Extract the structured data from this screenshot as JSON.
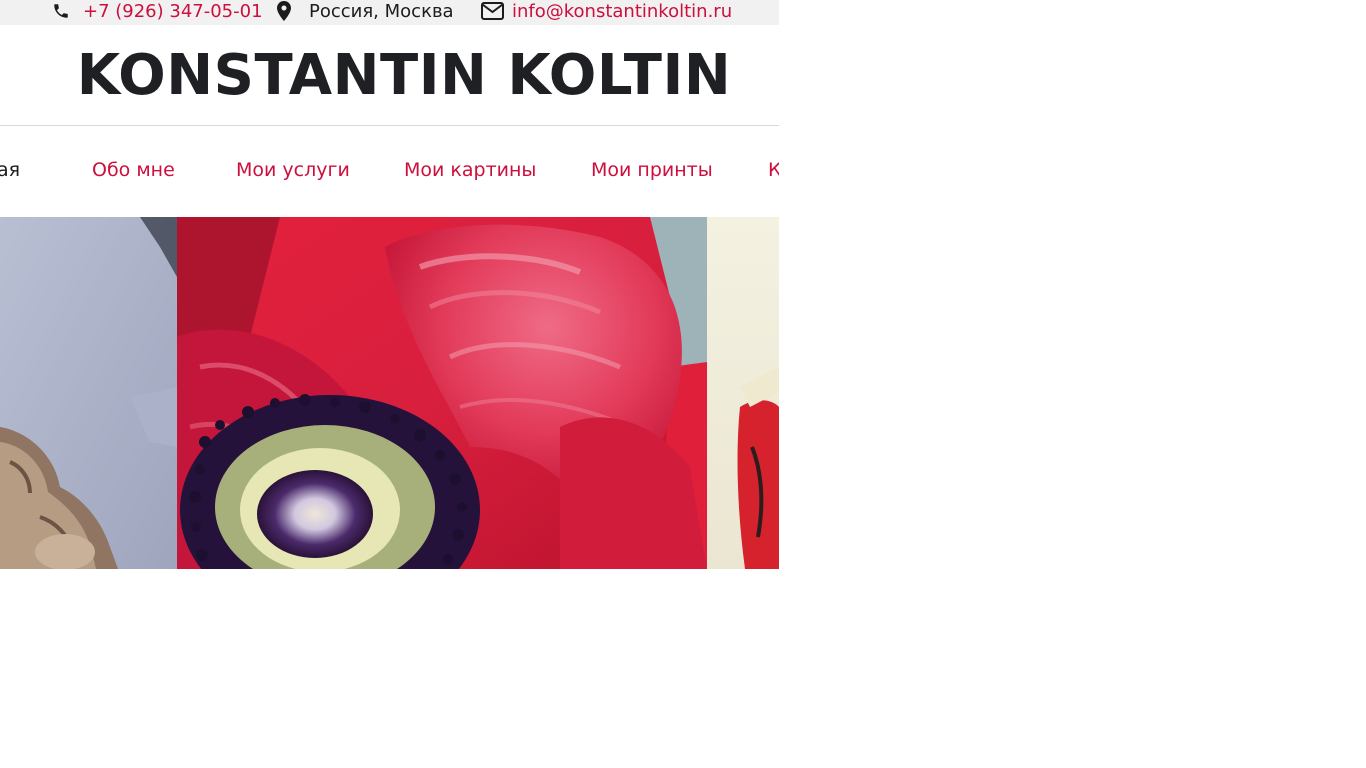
{
  "topbar": {
    "phone": "+7 (926) 347-05-01",
    "location": "Россия, Москва",
    "email": "info@konstantinkoltin.ru",
    "icons": [
      "phone-icon",
      "map-pin-icon",
      "envelope-icon"
    ]
  },
  "header": {
    "logo": "KONSTANTIN KOLTIN"
  },
  "nav": {
    "items": [
      {
        "label": "Главная",
        "state": "active"
      },
      {
        "label": "Обо мне"
      },
      {
        "label": "Мои услуги"
      },
      {
        "label": "Мои картины"
      },
      {
        "label": "Мои принты"
      },
      {
        "label": "Контакты"
      }
    ]
  },
  "slider": {
    "slides": [
      "painted-hand-slide",
      "red-poppy-painting-slide",
      "poppy-tshirt-slide"
    ]
  },
  "colors": {
    "accent": "#cc0f3c",
    "text_dark": "#1c1c1c",
    "topbar_bg": "#f1f1f1"
  }
}
